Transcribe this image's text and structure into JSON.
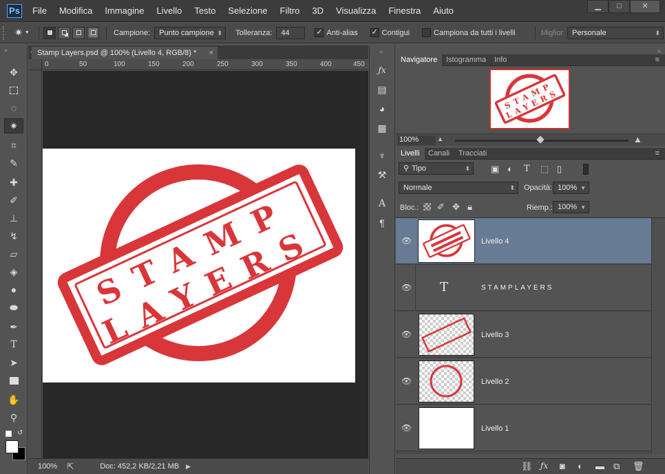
{
  "menubar": {
    "logo": "Ps",
    "items": [
      "File",
      "Modifica",
      "Immagine",
      "Livello",
      "Testo",
      "Selezione",
      "Filtro",
      "3D",
      "Visualizza",
      "Finestra",
      "Aiuto"
    ],
    "window_buttons": {
      "minimize": "▁",
      "maximize": "□",
      "close": "✕"
    }
  },
  "options": {
    "campione_label": "Campione:",
    "campione_value": "Punto campione",
    "tolleranza_label": "Tolleranza:",
    "tolleranza_value": "44",
    "antialias_label": "Anti-alias",
    "antialias_checked": true,
    "contigui_label": "Contigui",
    "contigui_checked": true,
    "campiona_label": "Campiona da tutti i livelli",
    "campiona_checked": false,
    "workspace_label": "Miglior",
    "workspace_value": "Personale"
  },
  "document": {
    "tab_title": "Stamp Layers.psd @ 100% (Livello 4, RGB/8) *",
    "close": "×",
    "ruler_ticks": [
      "0",
      "50",
      "100",
      "150",
      "200",
      "250",
      "300",
      "350",
      "400",
      "450"
    ],
    "stamp_line1": "STAMP",
    "stamp_line2": "LAYERS",
    "stamp_color": "#d9363a",
    "zoom": "100%",
    "doc_info": "Doc: 452,2 KB/2,21 MB"
  },
  "navigator": {
    "tabs": [
      "Navigatore",
      "Istogramma",
      "Info"
    ],
    "zoom": "100%",
    "thumb_line1": "STAMP",
    "thumb_line2": "LAYERS"
  },
  "layers_panel": {
    "tabs": [
      "Livelli",
      "Canali",
      "Tracciati"
    ],
    "filter_label": "Tipo",
    "blend_mode": "Normale",
    "opacity_label": "Opacità:",
    "opacity_value": "100%",
    "lock_label": "Bloc.:",
    "fill_label": "Riemp.:",
    "fill_value": "100%",
    "layers": [
      {
        "name": "Livello 4",
        "type": "stamp",
        "selected": true
      },
      {
        "name": "STAMPLAYERS",
        "type": "text",
        "selected": false
      },
      {
        "name": "Livello 3",
        "type": "rect",
        "selected": false
      },
      {
        "name": "Livello 2",
        "type": "circle",
        "selected": false
      },
      {
        "name": "Livello 1",
        "type": "white",
        "selected": false
      }
    ]
  },
  "colors": {
    "accent": "#55a9ff",
    "selected_layer": "#687b94",
    "stamp_red": "#d9363a"
  }
}
